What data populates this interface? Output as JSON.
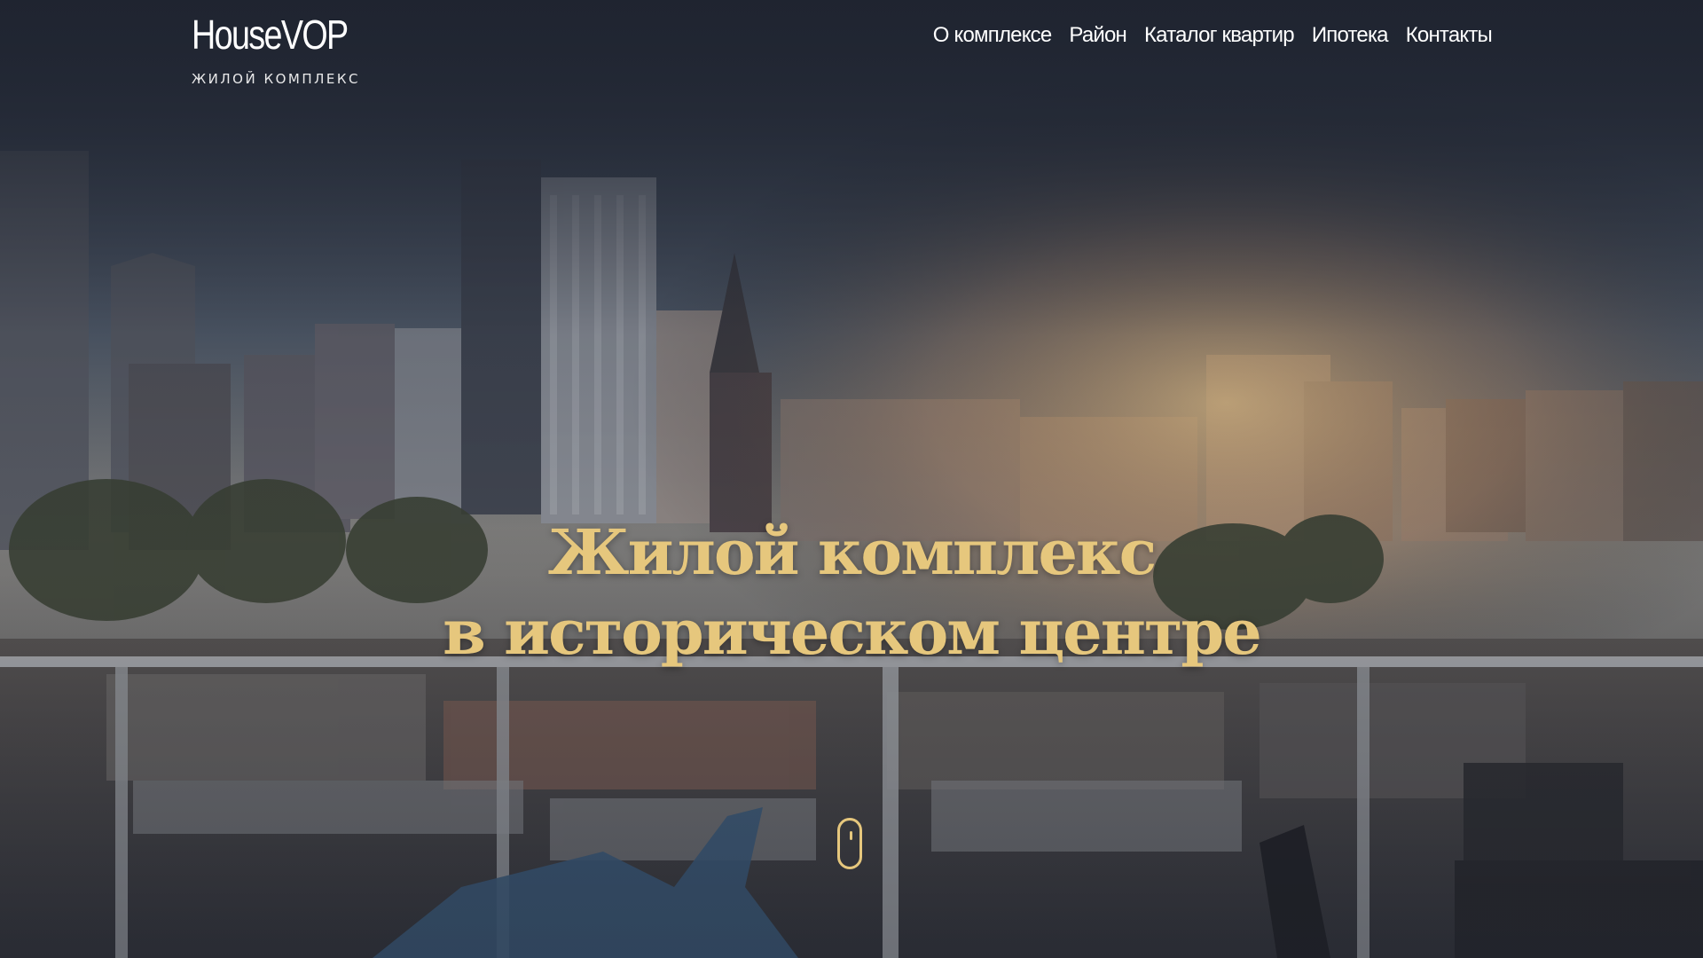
{
  "header": {
    "logo": {
      "title": "HouseVOP",
      "subtitle": "ЖИЛОЙ КОМПЛЕКС"
    },
    "nav": [
      {
        "label": "О комплексе"
      },
      {
        "label": "Район"
      },
      {
        "label": "Каталог квартир"
      },
      {
        "label": "Ипотека"
      },
      {
        "label": "Контакты"
      }
    ]
  },
  "hero": {
    "title_line1": "Жилой комплекс",
    "title_line2": "в историческом центре",
    "accent_color": "#e6c77d",
    "background": "city-skyline-photo",
    "scroll_icon": "mouse-scroll-icon"
  }
}
